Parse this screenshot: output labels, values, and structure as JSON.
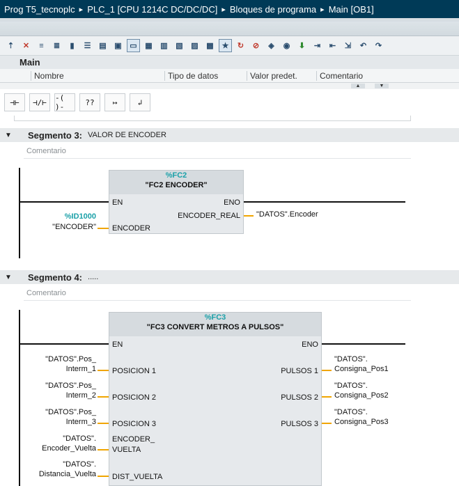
{
  "breadcrumb": {
    "project": "Prog T5_tecnoplc",
    "device": "PLC_1 [CPU 1214C DC/DC/DC]",
    "folder": "Bloques de programa",
    "block": "Main [OB1]",
    "separator": "▸"
  },
  "interface": {
    "title": "Main",
    "columns": [
      "Nombre",
      "Tipo de datos",
      "Valor predet.",
      "Comentario"
    ]
  },
  "ladder_elements": [
    "⊣⊢",
    "⊣/⊢",
    "-( )-",
    "??",
    "↦",
    "↲"
  ],
  "segment3": {
    "label": "Segmento 3:",
    "comment_title": "VALOR DE ENCODER",
    "comment_placeholder": "Comentario",
    "instance": "%FC2",
    "block_name": "\"FC2 ENCODER\"",
    "en": "EN",
    "eno": "ENO",
    "inputs": [
      {
        "pin": "ENCODER",
        "addr": "%ID1000",
        "tag": "\"ENCODER\""
      }
    ],
    "outputs": [
      {
        "pin": "ENCODER_REAL",
        "tag": "\"DATOS\".Encoder"
      }
    ]
  },
  "segment4": {
    "label": "Segmento 4:",
    "comment_title": ".....",
    "comment_placeholder": "Comentario",
    "instance": "%FC3",
    "block_name": "\"FC3 CONVERT METROS A PULSOS\"",
    "en": "EN",
    "eno": "ENO",
    "inputs": [
      {
        "pin": "POSICION 1",
        "tag1": "\"DATOS\".Pos_",
        "tag2": "Interm_1"
      },
      {
        "pin": "POSICION 2",
        "tag1": "\"DATOS\".Pos_",
        "tag2": "Interm_2"
      },
      {
        "pin": "POSICION 3",
        "tag1": "\"DATOS\".Pos_",
        "tag2": "Interm_3"
      },
      {
        "pin1": "ENCODER_",
        "pin2": "VUELTA",
        "tag1": "\"DATOS\".",
        "tag2": "Encoder_Vuelta"
      },
      {
        "pin": "DIST_VUELTA",
        "tag1": "\"DATOS\".",
        "tag2": "Distancia_Vuelta"
      }
    ],
    "outputs": [
      {
        "pin": "PULSOS 1",
        "tag1": "\"DATOS\".",
        "tag2": "Consigna_Pos1"
      },
      {
        "pin": "PULSOS 2",
        "tag1": "\"DATOS\".",
        "tag2": "Consigna_Pos2"
      },
      {
        "pin": "PULSOS 3",
        "tag1": "\"DATOS\".",
        "tag2": "Consigna_Pos3"
      }
    ]
  }
}
